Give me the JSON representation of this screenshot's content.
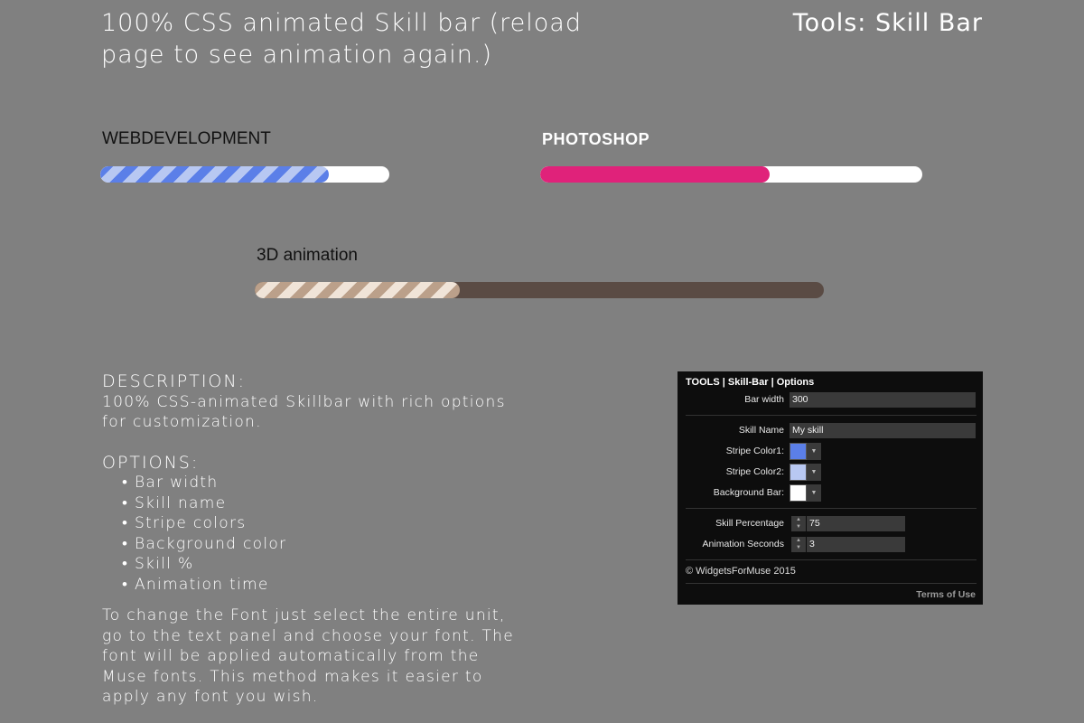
{
  "header": {
    "title_line1": "100% CSS animated Skill bar (reload",
    "title_line2": "page to see animation again.)",
    "right": "Tools: Skill Bar"
  },
  "skills": [
    {
      "name": "WEBDEVELOPMENT",
      "percent": 0.79,
      "track_color": "#ffffff",
      "fill_style": "stripes",
      "fill_colors": [
        "#5b7fe8",
        "#b8c8f2"
      ]
    },
    {
      "name": "PHOTOSHOP",
      "percent": 0.6,
      "track_color": "#ffffff",
      "fill_style": "solid",
      "fill_colors": [
        "#e0227a"
      ]
    },
    {
      "name": "3D animation",
      "percent": 0.36,
      "track_color": "#5a4b44",
      "fill_style": "stripes",
      "fill_colors": [
        "#bba08a",
        "#f0e4d8"
      ]
    }
  ],
  "description": {
    "heading": "DESCRIPTION:",
    "line1": "100% CSS-animated Skillbar with rich options",
    "line2": "for customization.",
    "options_heading": "OPTIONS:",
    "options": [
      "Bar width",
      "Skill name",
      "Stripe colors",
      "Background color",
      "Skill %",
      "Animation time"
    ],
    "font_note_lines": [
      "To change the Font just select the entire unit,",
      "go to the text panel and choose your font. The",
      "font will be applied automatically from the",
      "Muse fonts. This method makes it easier to",
      "apply any font you wish."
    ]
  },
  "panel": {
    "title": "TOOLS | Skill-Bar |  Options",
    "bar_width_label": "Bar width",
    "bar_width_value": "300",
    "skill_name_label": "Skill Name",
    "skill_name_value": "My skill",
    "stripe1_label": "Stripe Color1:",
    "stripe1_color": "#5b7fe8",
    "stripe2_label": "Stripe Color2:",
    "stripe2_color": "#b8c8f2",
    "bg_label": "Background Bar:",
    "bg_color": "#ffffff",
    "skill_pct_label": "Skill Percentage",
    "skill_pct_value": "75",
    "anim_label": "Animation Seconds",
    "anim_value": "3",
    "footer": "© WidgetsForMuse 2015",
    "terms": "Terms of Use"
  }
}
